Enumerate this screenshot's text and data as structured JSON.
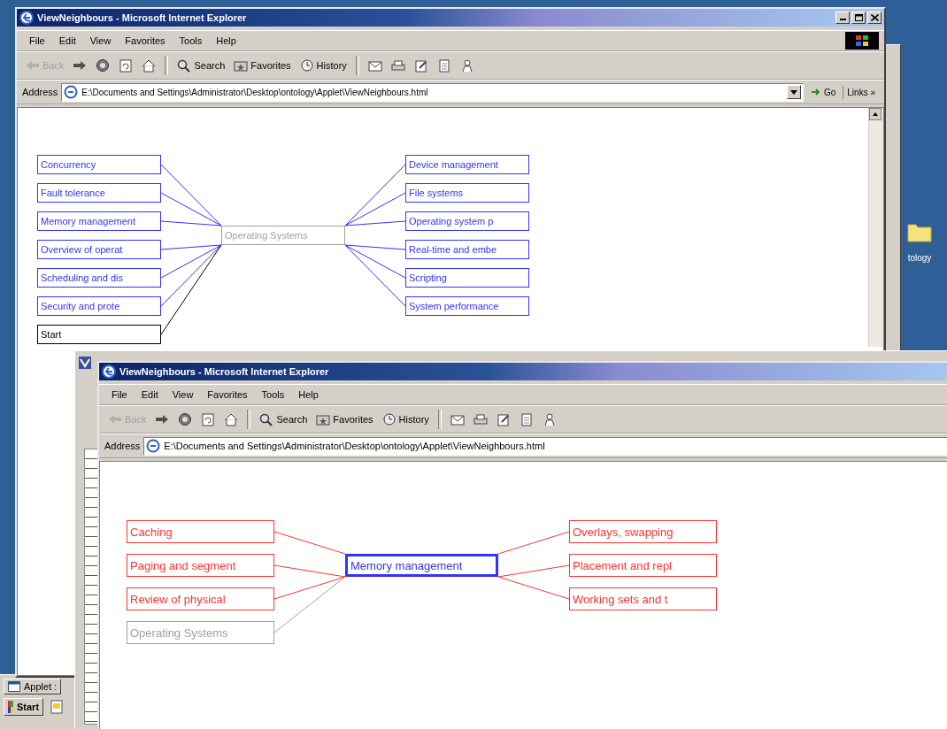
{
  "desktop": {
    "icon_label": "tology"
  },
  "taskbar": {
    "start": "Start",
    "tasks": [
      "Applet :"
    ]
  },
  "windows": [
    {
      "title": "ViewNeighbours - Microsoft Internet Explorer",
      "controls": true,
      "logo": true,
      "vertical_scrollbar": true,
      "menu": [
        "File",
        "Edit",
        "View",
        "Favorites",
        "Tools",
        "Help"
      ],
      "toolbar": [
        {
          "kind": "back",
          "label": "Back",
          "disabled": true
        },
        {
          "kind": "forward",
          "disabled": false
        },
        {
          "kind": "stop",
          "disabled": false
        },
        {
          "kind": "refresh",
          "disabled": false
        },
        {
          "kind": "home",
          "disabled": false
        },
        {
          "kind": "search",
          "label": "Search",
          "disabled": false
        },
        {
          "kind": "favorites",
          "label": "Favorites",
          "disabled": false
        },
        {
          "kind": "history",
          "label": "History",
          "disabled": false
        },
        {
          "kind": "mail",
          "disabled": false
        },
        {
          "kind": "print",
          "disabled": false
        },
        {
          "kind": "edit",
          "disabled": false
        },
        {
          "kind": "discuss",
          "disabled": false
        },
        {
          "kind": "messenger",
          "disabled": false
        }
      ],
      "address": {
        "label": "Address",
        "url": "E:\\Documents and Settings\\Administrator\\Desktop\\ontology\\Applet\\ViewNeighbours.html",
        "go": "Go",
        "links": "Links »"
      },
      "graph": {
        "center": {
          "label": "Operating Systems",
          "color": "#a0a0a0",
          "emphasized": false
        },
        "left": [
          {
            "label": "Concurrency",
            "color": "#3333ff"
          },
          {
            "label": "Fault tolerance",
            "color": "#3333ff"
          },
          {
            "label": "Memory management",
            "color": "#3333ff"
          },
          {
            "label": "Overview of operat",
            "color": "#3333ff"
          },
          {
            "label": "Scheduling and dis",
            "color": "#3333ff"
          },
          {
            "label": "Security and prote",
            "color": "#3333ff"
          },
          {
            "label": "Start",
            "color": "#000000"
          }
        ],
        "right": [
          {
            "label": "Device management",
            "color": "#3333ff"
          },
          {
            "label": "File systems",
            "color": "#3333ff"
          },
          {
            "label": "Operating system p",
            "color": "#3333ff"
          },
          {
            "label": "Real-time and embe",
            "color": "#3333ff"
          },
          {
            "label": "Scripting",
            "color": "#3333ff"
          },
          {
            "label": "System performance",
            "color": "#3333ff"
          }
        ]
      }
    },
    {
      "title": "ViewNeighbours - Microsoft Internet Explorer",
      "menu": [
        "File",
        "Edit",
        "View",
        "Favorites",
        "Tools",
        "Help"
      ],
      "toolbar": [
        {
          "kind": "back",
          "label": "Back",
          "disabled": true
        },
        {
          "kind": "forward",
          "disabled": false
        },
        {
          "kind": "stop",
          "disabled": false
        },
        {
          "kind": "refresh",
          "disabled": false
        },
        {
          "kind": "home",
          "disabled": false
        },
        {
          "kind": "search",
          "label": "Search",
          "disabled": false
        },
        {
          "kind": "favorites",
          "label": "Favorites",
          "disabled": false
        },
        {
          "kind": "history",
          "label": "History",
          "disabled": false
        },
        {
          "kind": "mail",
          "disabled": false
        },
        {
          "kind": "print",
          "disabled": false
        },
        {
          "kind": "edit",
          "disabled": false
        },
        {
          "kind": "discuss",
          "disabled": false
        },
        {
          "kind": "messenger",
          "disabled": false
        }
      ],
      "address": {
        "label": "Address",
        "url": "E:\\Documents and Settings\\Administrator\\Desktop\\ontology\\Applet\\ViewNeighbours.html"
      },
      "graph": {
        "center": {
          "label": "Memory management",
          "color": "#3333ff",
          "emphasized": true
        },
        "left": [
          {
            "label": "Caching",
            "color": "#ff3333"
          },
          {
            "label": "Paging and segment",
            "color": "#ff3333"
          },
          {
            "label": "Review of physical",
            "color": "#ff3333"
          },
          {
            "label": "Operating Systems",
            "color": "#a0a0a0"
          }
        ],
        "right": [
          {
            "label": "Overlays, swapping",
            "color": "#ff3333"
          },
          {
            "label": "Placement and repl",
            "color": "#ff3333"
          },
          {
            "label": "Working sets and t",
            "color": "#ff3333"
          }
        ]
      }
    }
  ]
}
